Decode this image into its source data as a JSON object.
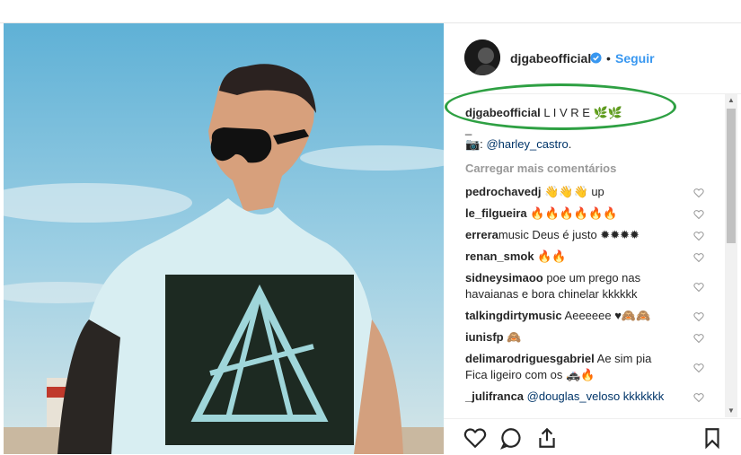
{
  "post": {
    "username": "djgabeofficial",
    "follow_label": "Seguir",
    "separator": "•",
    "caption_user": "djgabeofficial",
    "caption_text": "L I V R E 🌿🌿",
    "caption_line2": "_",
    "credit_prefix": "📷:",
    "credit_handle": "@harley_castro",
    "credit_suffix": ".",
    "load_more": "Carregar mais comentários"
  },
  "comments": [
    {
      "user": "pedrochavedj",
      "text": "👋👋👋 up",
      "line2": ""
    },
    {
      "user": "le_filgueira",
      "text": "🔥🔥🔥🔥🔥🔥",
      "line2": ""
    },
    {
      "user": "errera",
      "text": "music Deus é justo ✹✹✹✹",
      "line2": ""
    },
    {
      "user": "renan_smok",
      "text": "🔥🔥",
      "line2": ""
    },
    {
      "user": "sidneysimaoo",
      "text": "poe um prego nas",
      "line2": "havaianas e bora chinelar kkkkkk"
    },
    {
      "user": "talkingdirtymusic",
      "text": "Aeeeeee ♥🙈🙈",
      "line2": ""
    },
    {
      "user": "iunisfp",
      "text": "🙈",
      "line2": ""
    },
    {
      "user": "delimarodriguesgabriel",
      "text": "Ae sim pia",
      "line2": "Fica ligeiro com os 🚓🔥"
    },
    {
      "user": "_julifranca",
      "text": "@douglas_veloso kkkkkkk",
      "line2": ""
    }
  ],
  "colors": {
    "link": "#003569",
    "follow": "#3897f0",
    "annotation": "#2ea043"
  },
  "icons": [
    "verified-badge-icon",
    "heart-icon",
    "comment-icon",
    "share-icon",
    "bookmark-icon"
  ]
}
